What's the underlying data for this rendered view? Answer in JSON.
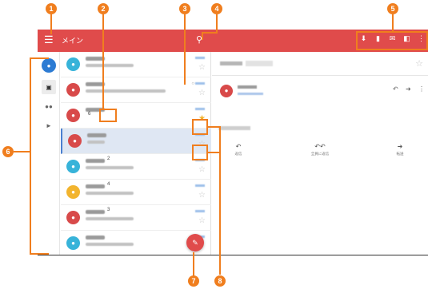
{
  "appbar": {
    "title": "メイン"
  },
  "icons": {
    "menu": "hamburger-icon",
    "search": "search-icon",
    "actions": [
      "download-icon",
      "trash-icon",
      "mail-icon",
      "folder-icon",
      "more-vert-icon"
    ]
  },
  "nav_rail": [
    "account-icon",
    "inbox-icon",
    "people-icon",
    "label-icon"
  ],
  "list": {
    "rows": [
      {
        "avatar_color": "#37b3d9",
        "count": "",
        "selected": false
      },
      {
        "avatar_color": "#d84a4a",
        "count": "",
        "selected": false
      },
      {
        "avatar_color": "#d84a4a",
        "count": "6",
        "selected": false
      },
      {
        "avatar_color": "#d84a4a",
        "count": "",
        "selected": true
      },
      {
        "avatar_color": "#37b3d9",
        "count": "2",
        "selected": false
      },
      {
        "avatar_color": "#f2b42e",
        "count": "4",
        "selected": false
      },
      {
        "avatar_color": "#d84a4a",
        "count": "3",
        "selected": false
      },
      {
        "avatar_color": "#37b3d9",
        "count": "",
        "selected": false
      }
    ]
  },
  "reading_pane": {
    "reply_actions": [
      "返信",
      "全員に返信",
      "転送"
    ]
  },
  "callouts": [
    "1",
    "2",
    "3",
    "4",
    "5",
    "6",
    "7",
    "8"
  ],
  "colors": {
    "appbar": "#e04b4b",
    "callout": "#f07e1e",
    "selection": "#dfe7f3"
  }
}
